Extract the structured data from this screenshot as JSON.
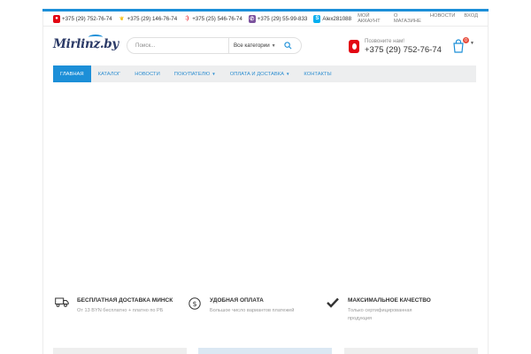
{
  "topbar": {
    "contacts": [
      {
        "operator": "mts",
        "icon": "mts-icon",
        "number": "+375 (29) 752-76-74"
      },
      {
        "operator": "velcom",
        "icon": "velcom-icon",
        "number": "+375 (29) 146-76-74"
      },
      {
        "operator": "life",
        "icon": "life-icon",
        "number": "+375 (25) 546-76-74"
      },
      {
        "operator": "viber",
        "icon": "viber-icon",
        "number": "+375 (29) 55-99-833"
      },
      {
        "operator": "skype",
        "icon": "skype-icon",
        "number": "Alex281088"
      }
    ],
    "links": [
      "МОЙ АККАУНТ",
      "О МАГАЗИНЕ",
      "НОВОСТИ",
      "ВХОД"
    ]
  },
  "header": {
    "logo_text": "Mirlinz.by",
    "search": {
      "placeholder": "Поиск...",
      "category": "Все категории"
    },
    "call": {
      "label": "Позвоните нам!",
      "number": "+375 (29) 752-76-74"
    },
    "cart": {
      "count": "0"
    }
  },
  "nav": {
    "items": [
      {
        "label": "ГЛАВНАЯ",
        "active": true,
        "dropdown": false
      },
      {
        "label": "КАТАЛОГ",
        "active": false,
        "dropdown": false
      },
      {
        "label": "НОВОСТИ",
        "active": false,
        "dropdown": false
      },
      {
        "label": "ПОКУПАТЕЛЮ",
        "active": false,
        "dropdown": true
      },
      {
        "label": "ОПЛАТА И ДОСТАВКА",
        "active": false,
        "dropdown": true
      },
      {
        "label": "КОНТАКТЫ",
        "active": false,
        "dropdown": false
      }
    ]
  },
  "features": [
    {
      "icon": "truck-icon",
      "title": "БЕСПЛАТНАЯ ДОСТАВКА МИНСК",
      "subtitle": "От 13 BYN бесплатно + платно по РБ"
    },
    {
      "icon": "dollar-icon",
      "title": "УДОБНАЯ ОПЛАТА",
      "subtitle": "Большое число вариантов платежей"
    },
    {
      "icon": "checkmark-icon",
      "title": "МАКСИМАЛЬНОЕ КАЧЕСТВО",
      "subtitle": "Только сертифицированная продукция"
    }
  ],
  "colors": {
    "accent": "#1c8fd8",
    "nav_background": "#edeeef",
    "mts_red": "#e30613"
  }
}
